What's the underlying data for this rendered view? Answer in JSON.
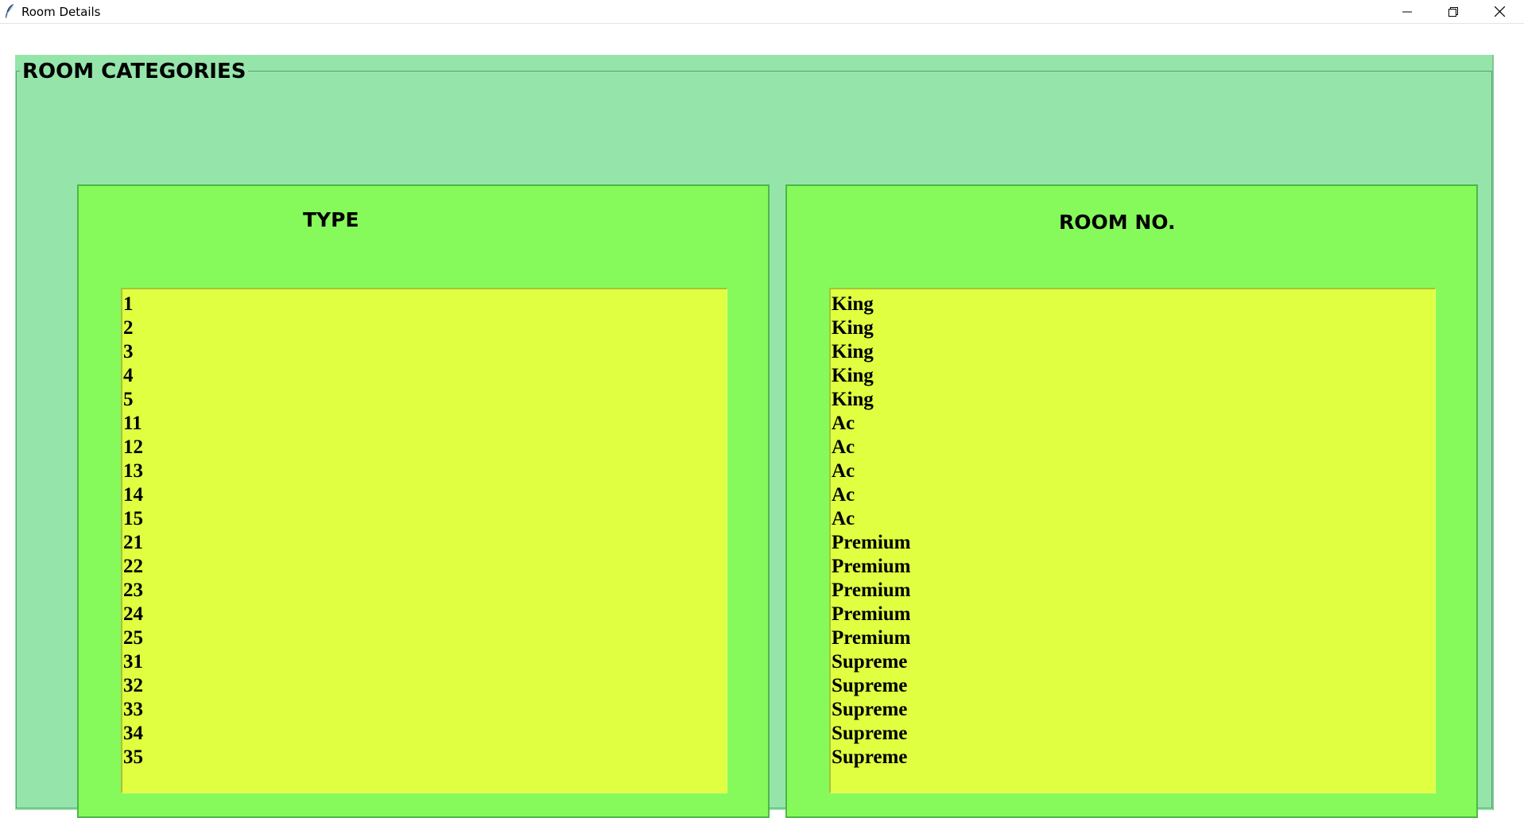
{
  "window": {
    "title": "Room Details"
  },
  "icons": {
    "app": "feather-icon",
    "minimize": "minimize-icon",
    "maximize": "restore-icon",
    "close": "close-icon"
  },
  "colors": {
    "frame_bg": "#95e5ab",
    "panel_bg": "#86fa5b",
    "listbox_bg": "#e0ff40"
  },
  "frame": {
    "title": "ROOM CATEGORIES"
  },
  "type_panel": {
    "heading": "TYPE",
    "items": [
      "1",
      "2",
      "3",
      "4",
      "5",
      "11",
      "12",
      "13",
      "14",
      "15",
      "21",
      "22",
      "23",
      "24",
      "25",
      "31",
      "32",
      "33",
      "34",
      "35"
    ]
  },
  "room_panel": {
    "heading": "ROOM NO.",
    "items": [
      "King",
      "King",
      "King",
      "King",
      "King",
      "Ac",
      "Ac",
      "Ac",
      "Ac",
      "Ac",
      "Premium",
      "Premium",
      "Premium",
      "Premium",
      "Premium",
      "Supreme",
      "Supreme",
      "Supreme",
      "Supreme",
      "Supreme"
    ]
  }
}
